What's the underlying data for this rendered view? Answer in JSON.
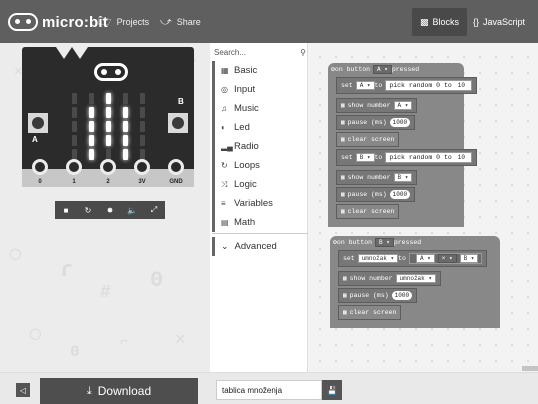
{
  "header": {
    "logo_text": "micro:bit",
    "nav": [
      {
        "label": "Projects",
        "icon": "folder-icon"
      },
      {
        "label": "Share",
        "icon": "share-icon"
      }
    ],
    "editor_toggle": {
      "blocks_label": "Blocks",
      "js_label": "JavaScript",
      "active": "Blocks"
    }
  },
  "simulator": {
    "button_a_label": "A",
    "button_b_label": "B",
    "pins": [
      "0",
      "1",
      "2",
      "3V",
      "GND"
    ],
    "led_matrix": [
      [
        0,
        0,
        1,
        0,
        0
      ],
      [
        0,
        1,
        1,
        1,
        0
      ],
      [
        0,
        1,
        1,
        1,
        0
      ],
      [
        0,
        1,
        1,
        1,
        0
      ],
      [
        0,
        1,
        0,
        1,
        0
      ]
    ],
    "toolbar": [
      "stop-icon",
      "restart-icon",
      "slowmo-icon",
      "mute-icon",
      "fullscreen-icon"
    ]
  },
  "toolbox": {
    "search_placeholder": "Search...",
    "categories": [
      {
        "label": "Basic",
        "icon": "grid-icon"
      },
      {
        "label": "Input",
        "icon": "target-icon"
      },
      {
        "label": "Music",
        "icon": "headphones-icon"
      },
      {
        "label": "Led",
        "icon": "toggle-icon"
      },
      {
        "label": "Radio",
        "icon": "signal-icon"
      },
      {
        "label": "Loops",
        "icon": "refresh-icon"
      },
      {
        "label": "Logic",
        "icon": "shuffle-icon"
      },
      {
        "label": "Variables",
        "icon": "list-icon"
      },
      {
        "label": "Math",
        "icon": "calculator-icon"
      }
    ],
    "advanced_label": "Advanced"
  },
  "workspace": {
    "event1": {
      "header": "on button",
      "button": "A",
      "suffix": "pressed",
      "blocks": [
        {
          "kind": "set",
          "text": "set",
          "var": "A",
          "to": "to",
          "value_text": "pick random 0 to",
          "value_num": "10"
        },
        {
          "kind": "show",
          "text": "show number",
          "value": "A"
        },
        {
          "kind": "pause",
          "text": "pause (ms)",
          "value": "1000"
        },
        {
          "kind": "clear",
          "text": "clear screen"
        },
        {
          "kind": "set",
          "text": "set",
          "var": "B",
          "to": "to",
          "value_text": "pick random 0 to",
          "value_num": "10"
        },
        {
          "kind": "show",
          "text": "show number",
          "value": "B"
        },
        {
          "kind": "pause",
          "text": "pause (ms)",
          "value": "1000"
        },
        {
          "kind": "clear",
          "text": "clear screen"
        }
      ]
    },
    "event2": {
      "header": "on button",
      "button": "B",
      "suffix": "pressed",
      "blocks": [
        {
          "kind": "setmul",
          "text": "set",
          "var": "umnožak",
          "to": "to",
          "left": "A",
          "op": "×",
          "right": "B"
        },
        {
          "kind": "show",
          "text": "show number",
          "value": "umnožak"
        },
        {
          "kind": "pause",
          "text": "pause (ms)",
          "value": "1000"
        },
        {
          "kind": "clear",
          "text": "clear screen"
        }
      ]
    }
  },
  "footer": {
    "download_label": "Download",
    "project_name": "tablica množenja"
  }
}
